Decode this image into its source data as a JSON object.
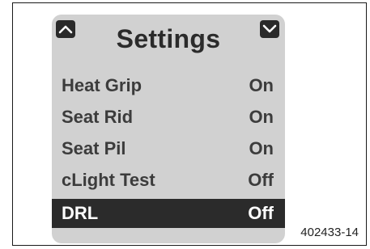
{
  "screen": {
    "title": "Settings",
    "nav": {
      "up_icon": "chevron-up-icon",
      "down_icon": "chevron-down-icon"
    },
    "items": [
      {
        "label": "Heat Grip",
        "value": "On"
      },
      {
        "label": "Seat Rid",
        "value": "On"
      },
      {
        "label": "Seat Pil",
        "value": "On"
      },
      {
        "label": "cLight Test",
        "value": "Off"
      },
      {
        "label": "DRL",
        "value": "Off",
        "selected": true
      }
    ]
  },
  "figure_id": "402433-14",
  "colors": {
    "screen_bg": "#d1d1d1",
    "text": "#3c3c3c",
    "highlight_bg": "#2b2b2b",
    "highlight_text": "#ffffff"
  }
}
